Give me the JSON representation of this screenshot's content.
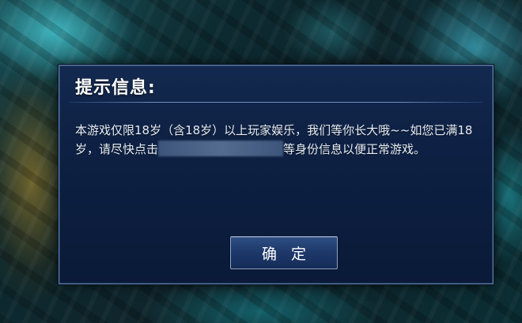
{
  "dialog": {
    "title": "提示信息:",
    "message_part1": "本游戏仅限18岁（含18岁）以上玩家娱乐，我们等你长大哦~~如您已满18岁，请尽快点击",
    "message_part2": "等身份信息以便正常游戏。",
    "confirm_label": "确 定"
  }
}
